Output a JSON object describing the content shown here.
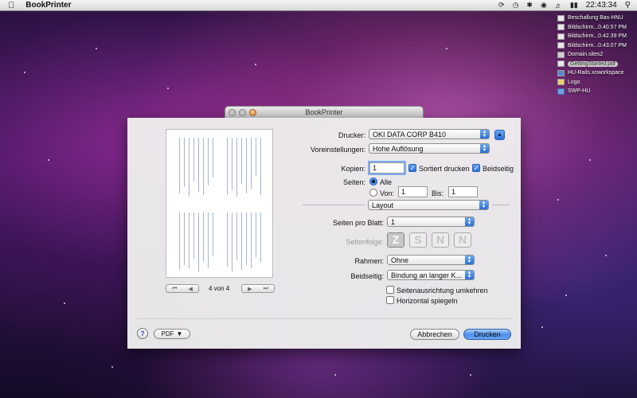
{
  "menubar": {
    "app_name": "BookPrinter",
    "clock": "22:43:34"
  },
  "desktop_files": [
    {
      "label": "Beschallung Bas-HNU",
      "icon": "document-icon",
      "selected": false
    },
    {
      "label": "Bildschirm...0.40.57 PM",
      "icon": "image-icon",
      "selected": false
    },
    {
      "label": "Bildschirm...0.42.39 PM",
      "icon": "image-icon",
      "selected": false
    },
    {
      "label": "Bildschirm...0.43.07 PM",
      "icon": "image-icon",
      "selected": false
    },
    {
      "label": "Domain.sites2",
      "icon": "site-icon",
      "selected": false
    },
    {
      "label": "GettingStarted.pdf",
      "icon": "pdf-icon",
      "selected": true
    },
    {
      "label": "HU-Rails.xcworkspace",
      "icon": "xcode-icon",
      "selected": false
    },
    {
      "label": "Logo",
      "icon": "logo-icon",
      "selected": false
    },
    {
      "label": "SWP-HU",
      "icon": "folder-icon",
      "selected": false
    }
  ],
  "window": {
    "title": "BookPrinter"
  },
  "print": {
    "printer_label": "Drucker:",
    "printer_value": "OKI DATA CORP B410",
    "presets_label": "Voreinstellungen:",
    "presets_value": "Hohe Auflösung",
    "copies_label": "Kopien:",
    "copies_value": "1",
    "collated_label": "Sortiert drucken",
    "collated_checked": true,
    "twosided_label": "Beidseitig",
    "twosided_checked": true,
    "pages_label": "Seiten:",
    "all_label": "Alle",
    "from_label": "Von:",
    "from_value": "1",
    "to_label": "Bis:",
    "to_value": "1",
    "section_value": "Layout",
    "pages_per_sheet_label": "Seiten pro Blatt:",
    "pages_per_sheet_value": "1",
    "layout_direction_label": "Seitenfolge:",
    "border_label": "Rahmen:",
    "border_value": "Ohne",
    "twosided_binding_label": "Beidseitig:",
    "twosided_binding_value": "Bindung an langer K...",
    "reverse_orientation_label": "Seitenausrichtung umkehren",
    "flip_horizontal_label": "Horizontal spiegeln",
    "page_count": "4 von 4",
    "help_glyph": "?",
    "pdf_label": "PDF",
    "cancel_label": "Abbrechen",
    "print_label": "Drucken"
  },
  "colors": {
    "accent": "#2a6fd8",
    "menubar": "#e6e6e6",
    "sheet": "#eeeeee"
  }
}
